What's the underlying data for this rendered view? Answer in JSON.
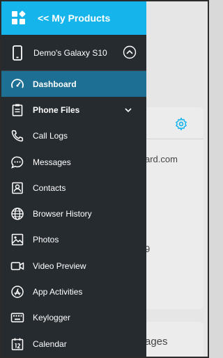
{
  "header": {
    "back_label": "<< My Products"
  },
  "device": {
    "name": "Demo's Galaxy S10"
  },
  "menu": [
    {
      "label": "Dashboard",
      "icon": "speedometer-icon"
    },
    {
      "label": "Phone Files",
      "icon": "clipboard-icon"
    },
    {
      "label": "Call Logs",
      "icon": "phone-icon"
    },
    {
      "label": "Messages",
      "icon": "chat-bubble-icon"
    },
    {
      "label": "Contacts",
      "icon": "contact-card-icon"
    },
    {
      "label": "Browser History",
      "icon": "globe-icon"
    },
    {
      "label": "Photos",
      "icon": "image-icon"
    },
    {
      "label": "Video Preview",
      "icon": "video-camera-icon"
    },
    {
      "label": "App Activities",
      "icon": "app-store-icon"
    },
    {
      "label": "Keylogger",
      "icon": "keyboard-icon"
    },
    {
      "label": "Calendar",
      "icon": "calendar-icon"
    }
  ],
  "background": {
    "email_fragment": "ard.com",
    "number_fragment": "9",
    "card_title_fragment": "ages"
  },
  "colors": {
    "accent": "#15b4ea",
    "drawer": "#262b30",
    "active": "#1d6f93"
  }
}
